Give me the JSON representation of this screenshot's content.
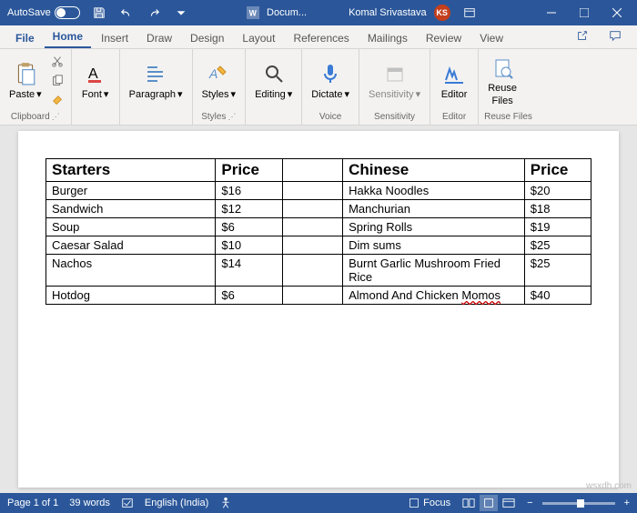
{
  "titlebar": {
    "autosave_label": "AutoSave",
    "doc_name": "Docum...",
    "user_name": "Komal Srivastava",
    "user_initials": "KS"
  },
  "tabs": {
    "file": "File",
    "home": "Home",
    "insert": "Insert",
    "draw": "Draw",
    "design": "Design",
    "layout": "Layout",
    "references": "References",
    "mailings": "Mailings",
    "review": "Review",
    "view": "View"
  },
  "ribbon": {
    "clipboard": {
      "paste": "Paste",
      "group": "Clipboard"
    },
    "font": {
      "btn": "Font"
    },
    "paragraph": {
      "btn": "Paragraph"
    },
    "styles": {
      "btn": "Styles",
      "group": "Styles"
    },
    "editing": {
      "btn": "Editing"
    },
    "voice": {
      "btn": "Dictate",
      "group": "Voice"
    },
    "sensitivity": {
      "btn": "Sensitivity",
      "group": "Sensitivity"
    },
    "editor": {
      "btn": "Editor",
      "group": "Editor"
    },
    "reuse": {
      "btn": "Reuse",
      "btn2": "Files",
      "group": "Reuse Files"
    }
  },
  "table": {
    "h1": "Starters",
    "p": "Price",
    "h2": "Chinese",
    "rows": [
      {
        "a": "Burger",
        "ap": "$16",
        "b": "Hakka Noodles",
        "bp": "$20"
      },
      {
        "a": "Sandwich",
        "ap": "$12",
        "b": "Manchurian",
        "bp": "$18"
      },
      {
        "a": "Soup",
        "ap": "$6",
        "b": "Spring Rolls",
        "bp": "$19"
      },
      {
        "a": "Caesar Salad",
        "ap": "$10",
        "b": "Dim sums",
        "bp": "$25"
      },
      {
        "a": "Nachos",
        "ap": "$14",
        "b": "Burnt Garlic Mushroom Fried Rice",
        "bp": "$25"
      },
      {
        "a": "Hotdog",
        "ap": "$6",
        "b_pre": "Almond And Chicken ",
        "b_spell": "Momos",
        "bp": "$40"
      }
    ]
  },
  "status": {
    "page": "Page 1 of 1",
    "words": "39 words",
    "lang": "English (India)",
    "focus": "Focus"
  },
  "watermark": "wsxdh.com"
}
